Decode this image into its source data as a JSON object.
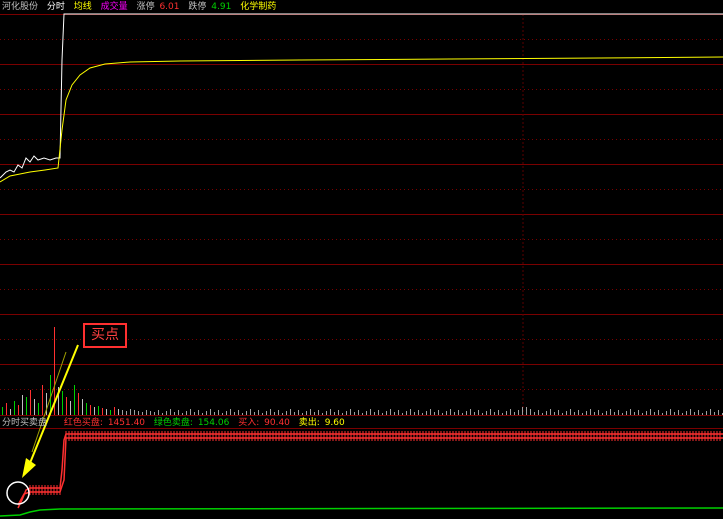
{
  "header": {
    "stock_name": "河化股份",
    "mode": "分时",
    "avg_line_label": "均线",
    "volume_label": "成交量",
    "limit_up_label": "涨停",
    "limit_up_value": "6.01",
    "limit_down_label": "跌停",
    "limit_down_value": "4.91",
    "sector": "化学制药"
  },
  "indicator": {
    "name": "分时买卖盘",
    "red_buy_label": "红色买盘:",
    "red_buy_value": "1451.40",
    "green_sell_label": "绿色卖盘:",
    "green_sell_value": "154.06",
    "buy_in_label": "买入:",
    "buy_in_value": "90.40",
    "sell_out_label": "卖出:",
    "sell_out_value": "9.60"
  },
  "annotation": {
    "buy_point": "买点"
  },
  "colors": {
    "background": "#000000",
    "price_line": "#ffffff",
    "avg_line": "#ffff00",
    "grid": "#8b0000",
    "up": "#ff3030",
    "down": "#00d000",
    "annotation_arrow": "#ffff00"
  },
  "chart_data": {
    "type": "line",
    "series": [],
    "volume_bars": "present",
    "grid": true
  }
}
